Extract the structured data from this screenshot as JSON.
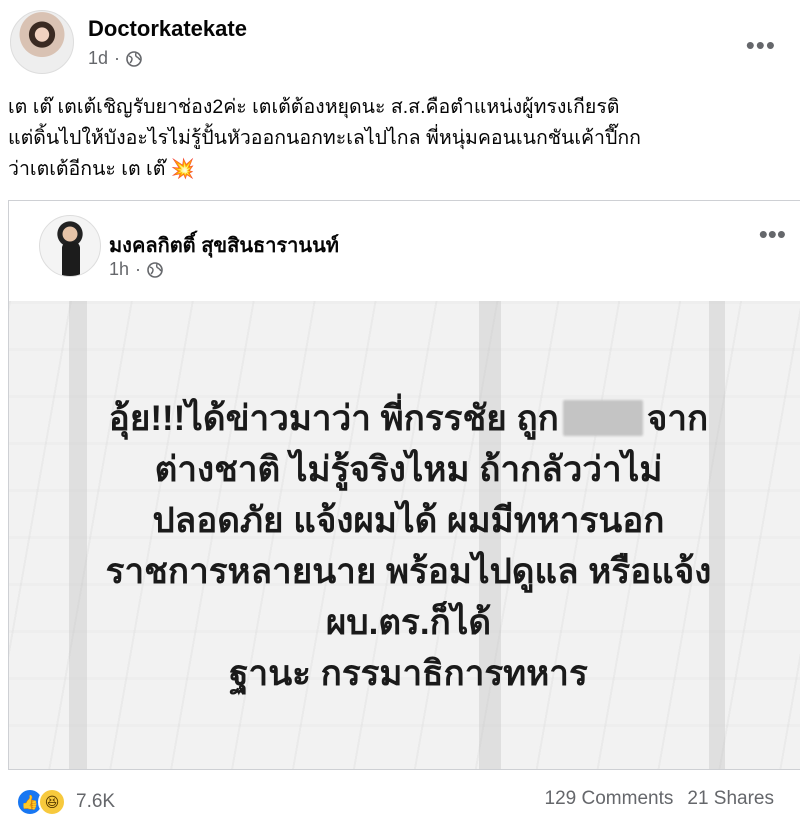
{
  "post": {
    "author": "Doctorkatekate",
    "time": "1d",
    "visibility_icon": "globe-icon",
    "caption": "เต เต๊ เตเต้เชิญรับยาช่อง2ค่ะ เตเต้ต้องหยุดนะ ส.ส.คือตำแหน่งผู้ทรงเกียรติ\nแต่ดิ้นไปให้บังอะไรไม่รู้ปั้นหัวออกนอกทะเลไปไกล พี่หนุ่มคอนเนกชันเค้าปี๊กก\nว่าเตเต้อีกนะ เต เต๊ 💥"
  },
  "shared_post": {
    "author": "มงคลกิตติ์ สุขสินธารานนท์",
    "time": "1h",
    "visibility_icon": "globe-icon",
    "message": {
      "line1_before": "อุ้ย!!!ได้ข่าวมาว่า พี่กรรชัย ถูก",
      "line1_after": "จาก",
      "line2": "ต่างชาติ ไม่รู้จริงไหม ถ้ากลัวว่าไม่",
      "line3": "ปลอดภัย แจ้งผมได้ ผมมีทหารนอก",
      "line4": "ราชการหลายนาย พร้อมไปดูแล หรือแจ้ง",
      "line5": "ผบ.ตร.ก็ได้",
      "line6": "ฐานะ กรรมาธิการทหาร"
    }
  },
  "footer": {
    "reactions_count": "7.6K",
    "comments": "129 Comments",
    "shares": "21 Shares"
  },
  "colors": {
    "facebook_blue": "#1877f2",
    "secondary_text": "#65676b",
    "border": "#ced0d4"
  }
}
